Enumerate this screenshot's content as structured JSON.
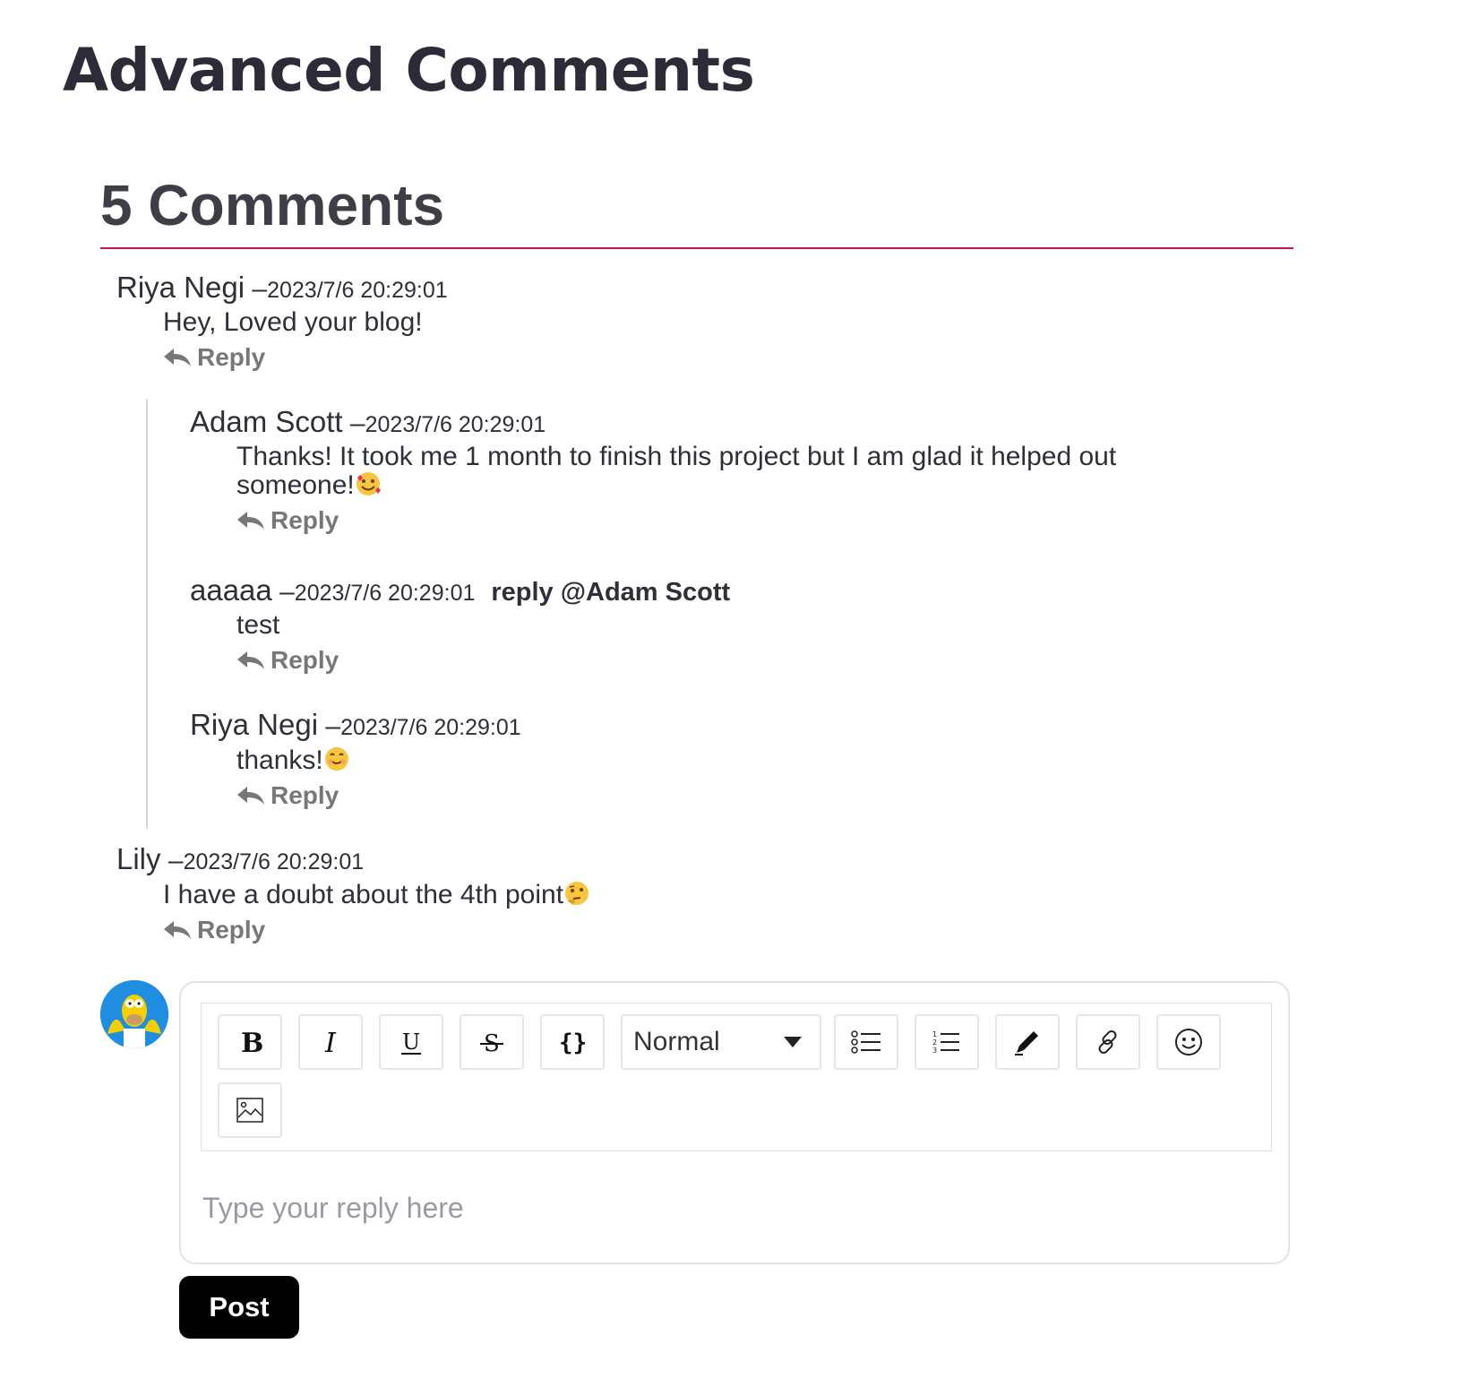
{
  "page": {
    "title": "Advanced Comments"
  },
  "comments_header": {
    "count_label": "5 Comments"
  },
  "comments": [
    {
      "author": "Riya Negi",
      "dash": " –",
      "time": "2023/7/6 20:29:01",
      "reply_to": "",
      "text": "Hey, Loved your blog!",
      "emoji": "",
      "reply_label": "Reply"
    },
    {
      "author": "Adam Scott",
      "dash": " –",
      "time": "2023/7/6 20:29:01",
      "reply_to": "",
      "text": "Thanks! It took me 1 month to finish this project but I am glad it helped out someone!",
      "emoji": "smiling-face-with-hearts",
      "reply_label": "Reply"
    },
    {
      "author": "aaaaa",
      "dash": " –",
      "time": "2023/7/6 20:29:01",
      "reply_to": "reply @Adam Scott",
      "text": "test",
      "emoji": "",
      "reply_label": "Reply"
    },
    {
      "author": "Riya Negi",
      "dash": " –",
      "time": "2023/7/6 20:29:01",
      "reply_to": "",
      "text": "thanks!",
      "emoji": "smiling-face",
      "reply_label": "Reply"
    },
    {
      "author": "Lily",
      "dash": " –",
      "time": "2023/7/6 20:29:01",
      "reply_to": "",
      "text": "I have a doubt about the 4th point",
      "emoji": "thinking-face",
      "reply_label": "Reply"
    }
  ],
  "editor": {
    "format_select": "Normal",
    "placeholder": "Type your reply here",
    "toolbar_icons": [
      "bold-icon",
      "italic-icon",
      "underline-icon",
      "strikethrough-icon",
      "code-icon",
      "bullet-list-icon",
      "ordered-list-icon",
      "pen-icon",
      "link-icon",
      "emoji-icon",
      "image-icon"
    ],
    "post_label": "Post"
  },
  "colors": {
    "accent_divider": "#c2185b",
    "post_button": "#000000",
    "reply_link": "#777777"
  }
}
